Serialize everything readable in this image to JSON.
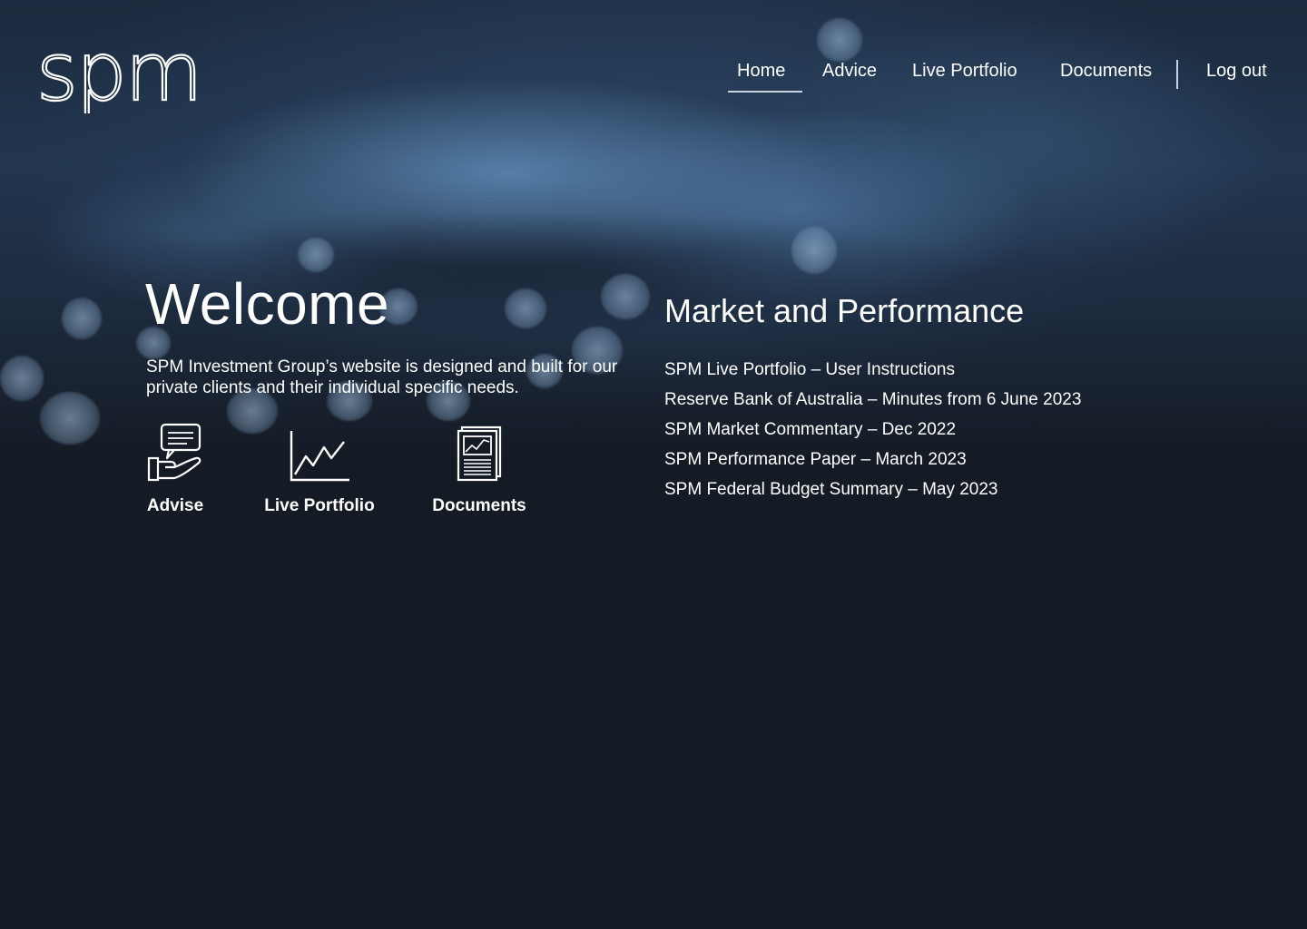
{
  "header": {
    "logo_text": "spm",
    "nav": {
      "home": "Home",
      "advice": "Advice",
      "live_portfolio": "Live Portfolio",
      "documents": "Documents",
      "logout": "Log out"
    },
    "active_nav": "Home"
  },
  "welcome": {
    "title": "Welcome",
    "text": "SPM Investment Group’s website is designed and built for our private clients and their individual specific needs.",
    "quick_links": [
      {
        "label": "Advise",
        "icon": "hand-chat-icon"
      },
      {
        "label": "Live Portfolio",
        "icon": "line-chart-icon"
      },
      {
        "label": "Documents",
        "icon": "document-stack-icon"
      }
    ]
  },
  "market": {
    "title": "Market and Performance",
    "links": [
      "SPM Live Portfolio – User Instructions",
      "Reserve Bank of Australia – Minutes from 6 June 2023",
      "SPM Market Commentary – Dec 2022",
      "SPM Performance Paper – March 2023",
      "SPM Federal Budget Summary – May 2023"
    ]
  },
  "colors": {
    "background": "#151b25",
    "text": "#ffffff",
    "accent_line": "#c8d3de"
  }
}
